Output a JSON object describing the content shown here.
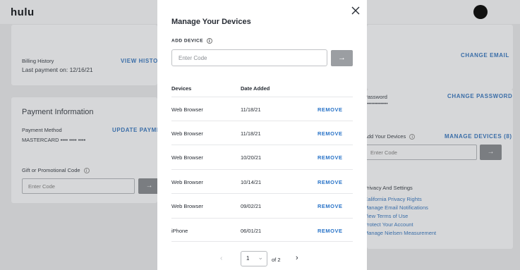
{
  "header": {
    "logo": "hulu"
  },
  "left": {
    "billing": {
      "label": "Billing History",
      "last_payment": "Last payment on: 12/16/21",
      "link": "VIEW HISTORY"
    },
    "payment": {
      "title": "Payment Information",
      "method_label": "Payment Method",
      "method_value": "MASTERCARD •••• •••• ••••",
      "update_link": "UPDATE PAYMENT",
      "gift_label": "Gift or Promotional Code",
      "gift_placeholder": "Enter Code",
      "arrow": "→"
    }
  },
  "right": {
    "change_email": "CHANGE EMAIL",
    "password_label": "Password",
    "password_value": "••••••••••••••••",
    "change_password": "CHANGE PASSWORD",
    "add_devices_label": "Add Your Devices",
    "manage_devices": "MANAGE DEVICES (8)",
    "code_placeholder": "Enter Code",
    "arrow": "→",
    "privacy_title": "Privacy And Settings",
    "privacy_links": [
      "California Privacy Rights",
      "Manage Email Notifications",
      "View Terms of Use",
      "Protect Your Account",
      "Manage Nielsen Measurement"
    ]
  },
  "modal": {
    "title": "Manage Your Devices",
    "add_device_label": "ADD DEVICE",
    "info": "i",
    "code_placeholder": "Enter Code",
    "submit_arrow": "→",
    "col_devices": "Devices",
    "col_date": "Date Added",
    "rows": [
      {
        "device": "Web Browser",
        "date": "11/18/21",
        "action": "REMOVE"
      },
      {
        "device": "Web Browser",
        "date": "11/18/21",
        "action": "REMOVE"
      },
      {
        "device": "Web Browser",
        "date": "10/20/21",
        "action": "REMOVE"
      },
      {
        "device": "Web Browser",
        "date": "10/14/21",
        "action": "REMOVE"
      },
      {
        "device": "Web Browser",
        "date": "09/02/21",
        "action": "REMOVE"
      },
      {
        "device": "iPhone",
        "date": "06/01/21",
        "action": "REMOVE"
      }
    ],
    "pager": {
      "prev": "‹",
      "page": "1",
      "chevron": "⌄",
      "of": "of 2",
      "next": "›"
    }
  }
}
